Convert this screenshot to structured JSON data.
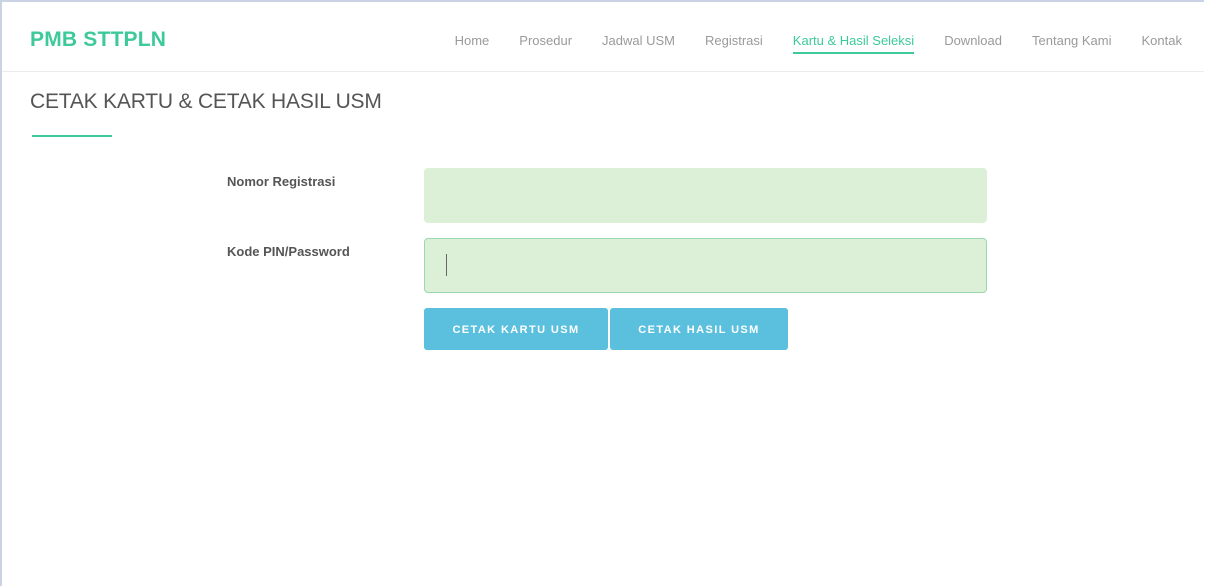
{
  "header": {
    "brand": "PMB STTPLN",
    "nav": [
      {
        "label": "Home",
        "active": false
      },
      {
        "label": "Prosedur",
        "active": false
      },
      {
        "label": "Jadwal USM",
        "active": false
      },
      {
        "label": "Registrasi",
        "active": false
      },
      {
        "label": "Kartu & Hasil Seleksi",
        "active": true
      },
      {
        "label": "Download",
        "active": false
      },
      {
        "label": "Tentang Kami",
        "active": false
      },
      {
        "label": "Kontak",
        "active": false
      }
    ]
  },
  "page": {
    "title": "CETAK KARTU & CETAK HASIL USM"
  },
  "form": {
    "registration_label": "Nomor Registrasi",
    "registration_value": "",
    "pin_label": "Kode PIN/Password",
    "pin_value": "",
    "print_card_button": "CETAK KARTU USM",
    "print_result_button": "CETAK HASIL USM"
  },
  "colors": {
    "accent": "#3ec99b",
    "input_bg": "#dcefd7",
    "button_bg": "#5bc0de"
  }
}
